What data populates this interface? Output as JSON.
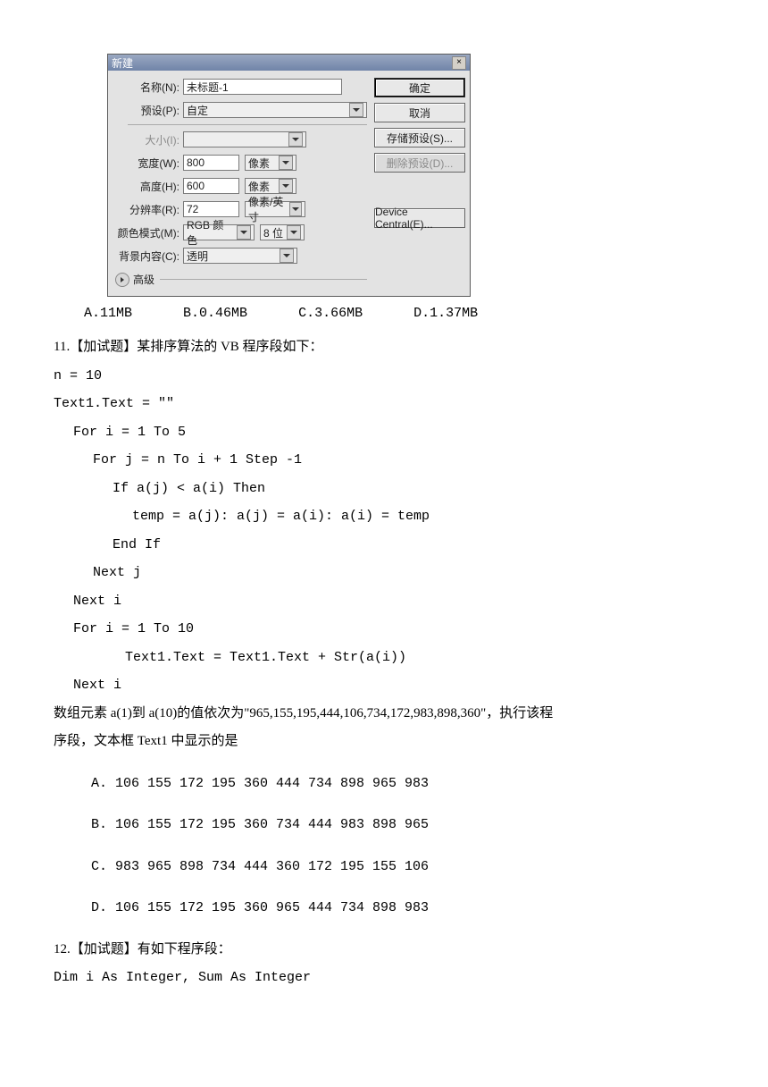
{
  "dialog": {
    "title": "新建",
    "close": "×",
    "labels": {
      "name": "名称(N):",
      "preset": "预设(P):",
      "size": "大小(I):",
      "width": "宽度(W):",
      "height": "高度(H):",
      "resolution": "分辨率(R):",
      "colorMode": "颜色模式(M):",
      "background": "背景内容(C):"
    },
    "values": {
      "name": "未标题-1",
      "preset": "自定",
      "size": "",
      "width": "800",
      "height": "600",
      "resolution": "72",
      "colorMode": "RGB 颜色",
      "bitDepth": "8 位",
      "background": "透明",
      "unitPx": "像素",
      "unitPpi": "像素/英寸"
    },
    "advanced": "高级",
    "buttons": {
      "ok": "确定",
      "cancel": "取消",
      "savePreset": "存储预设(S)...",
      "deletePreset": "删除预设(D)...",
      "deviceCentral": "Device Central(E)..."
    }
  },
  "q10_options": {
    "a": "A.11MB",
    "b": "B.0.46MB",
    "c": "C.3.66MB",
    "d": "D.1.37MB"
  },
  "q11": {
    "stem": "11.【加试题】某排序算法的 VB 程序段如下：",
    "line1": "n = 10",
    "line2": "Text1.Text = \"\"",
    "line3": "For i = 1 To 5",
    "line4": "For j = n To i + 1 Step -1",
    "line5": "If a(j) < a(i) Then",
    "line6": "temp = a(j): a(j) = a(i): a(i) = temp",
    "line7": "End If",
    "line8": "Next j",
    "line9": "Next i",
    "line10": "For i = 1 To 10",
    "line11": "Text1.Text = Text1.Text + Str(a(i))",
    "line12": "Next i",
    "desc1": "数组元素 a(1)到 a(10)的值依次为\"965,155,195,444,106,734,172,983,898,360\"，执行该程",
    "desc2": "序段，文本框 Text1 中显示的是",
    "optA": "A. 106 155 172 195 360 444 734 898 965 983",
    "optB": "B. 106 155 172 195 360 734 444 983 898 965",
    "optC": "C. 983 965 898 734 444 360 172 195 155 106",
    "optD": "D. 106 155 172 195 360 965 444 734 898 983"
  },
  "q12": {
    "stem": "12.【加试题】有如下程序段：",
    "line1": "Dim i As Integer, Sum As Integer"
  }
}
